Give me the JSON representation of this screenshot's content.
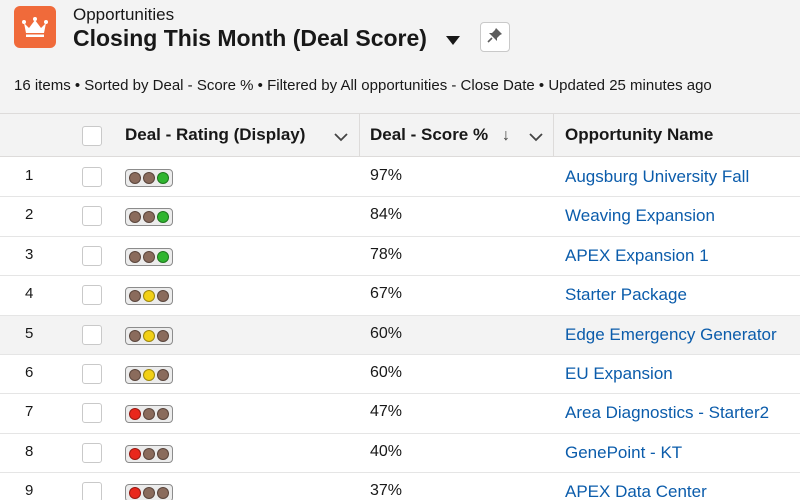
{
  "header": {
    "object_label": "Opportunities",
    "list_title": "Closing This Month (Deal Score)",
    "app_icon": "crown-icon",
    "meta": "16 items • Sorted by Deal - Score % • Filtered by All opportunities - Close Date • Updated 25 minutes ago",
    "icon_color": "#f06a3a"
  },
  "columns": {
    "rating": "Deal - Rating (Display)",
    "score": "Deal - Score %",
    "name": "Opportunity Name",
    "sort_icon": "↓"
  },
  "colors": {
    "link": "#0b5cab",
    "red": "#e8271c",
    "yellow": "#f2d016",
    "green": "#2fb52f",
    "off": "#8a6b5c"
  },
  "rows": [
    {
      "num": "1",
      "rating": "green",
      "score": "97%",
      "name": "Augsburg University Fall"
    },
    {
      "num": "2",
      "rating": "green",
      "score": "84%",
      "name": "Weaving Expansion"
    },
    {
      "num": "3",
      "rating": "green",
      "score": "78%",
      "name": "APEX Expansion 1"
    },
    {
      "num": "4",
      "rating": "yellow",
      "score": "67%",
      "name": "Starter Package"
    },
    {
      "num": "5",
      "rating": "yellow",
      "score": "60%",
      "name": "Edge Emergency Generator"
    },
    {
      "num": "6",
      "rating": "yellow",
      "score": "60%",
      "name": "EU Expansion"
    },
    {
      "num": "7",
      "rating": "red",
      "score": "47%",
      "name": "Area Diagnostics - Starter2"
    },
    {
      "num": "8",
      "rating": "red",
      "score": "40%",
      "name": "GenePoint - KT"
    },
    {
      "num": "9",
      "rating": "red",
      "score": "37%",
      "name": "APEX Data Center"
    }
  ]
}
